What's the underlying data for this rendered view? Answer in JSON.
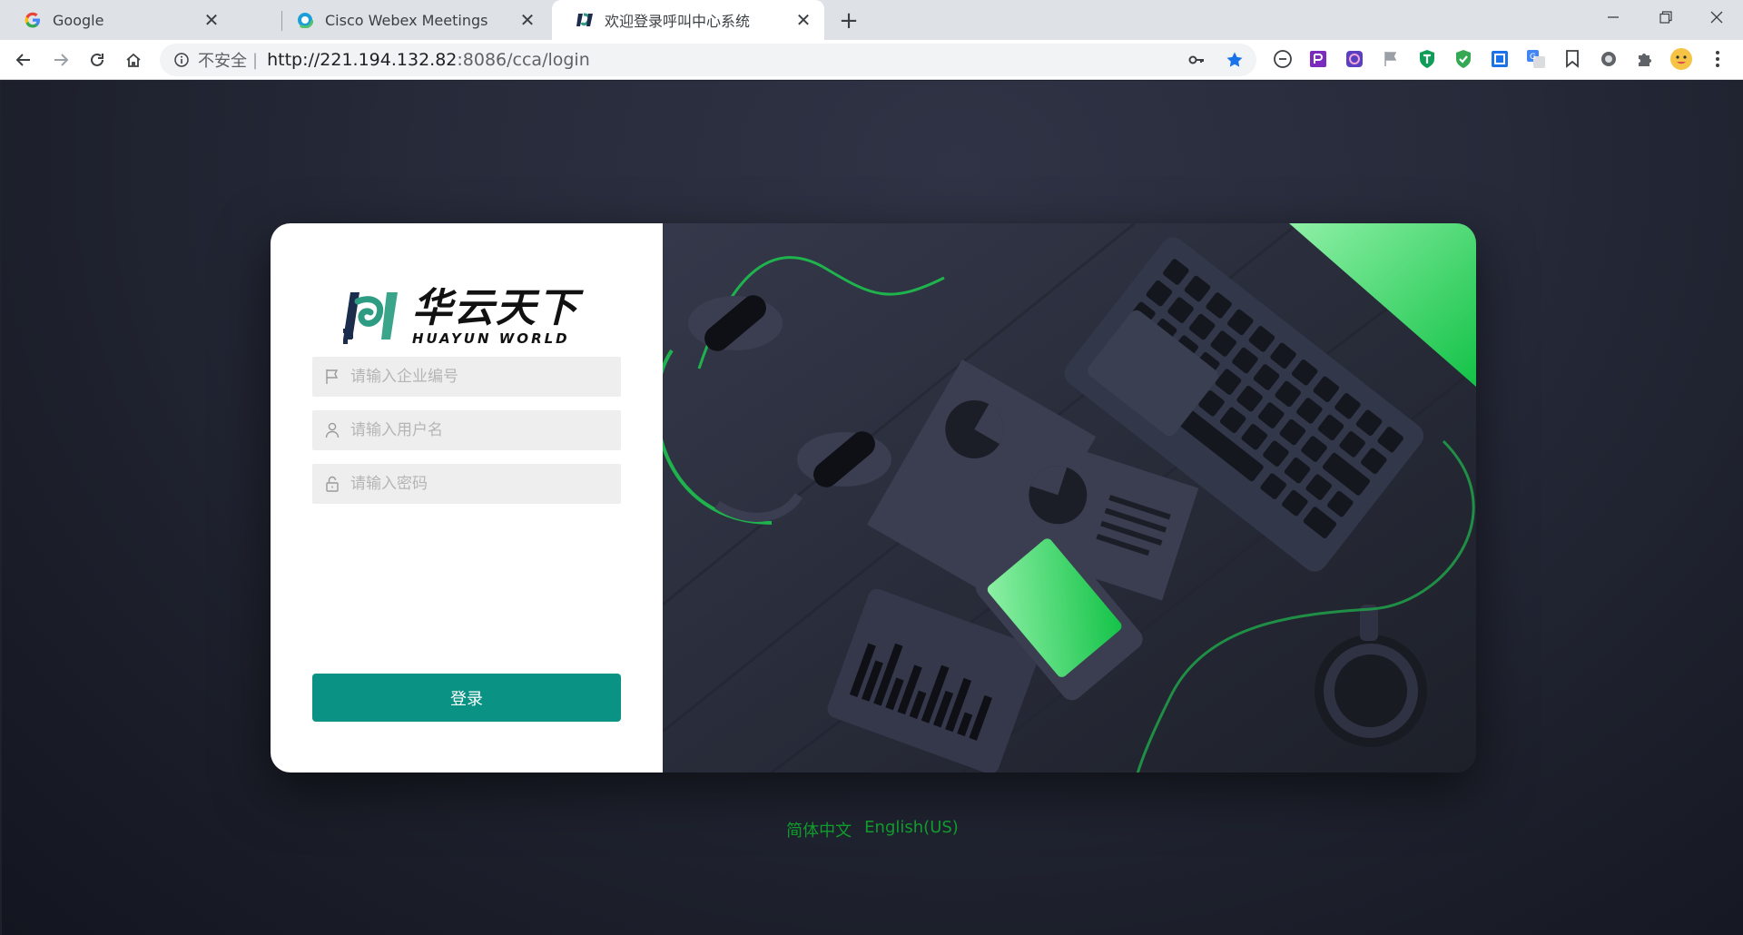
{
  "browser": {
    "tabs": [
      {
        "title": "Google",
        "favicon": "google-icon"
      },
      {
        "title": "Cisco Webex Meetings",
        "favicon": "webex-icon"
      },
      {
        "title": "欢迎登录呼叫中心系统",
        "favicon": "huayun-icon",
        "active": true
      }
    ],
    "address": {
      "security_label": "不安全",
      "separator": "|",
      "url_host": "http://221.194.132.82",
      "url_path": ":8086/cca/login"
    }
  },
  "login": {
    "brand_cn": "华云天下",
    "brand_en": "HUAYUN WORLD",
    "company_placeholder": "请输入企业编号",
    "username_placeholder": "请输入用户名",
    "password_placeholder": "请输入密码",
    "submit_label": "登录"
  },
  "languages": {
    "zh": "简体中文",
    "en": "English(US)"
  },
  "colors": {
    "accent": "#0a9384",
    "lang_link": "#109c2d",
    "illustration_green": "#3ddc6e"
  }
}
